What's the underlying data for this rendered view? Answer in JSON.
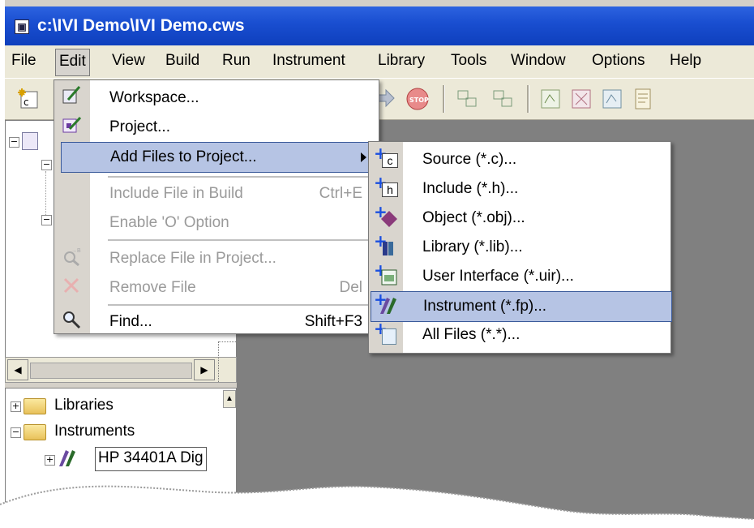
{
  "window": {
    "title": "c:\\IVI Demo\\IVI Demo.cws"
  },
  "menubar": {
    "items": [
      {
        "label": "File"
      },
      {
        "label": "Edit"
      },
      {
        "label": "View"
      },
      {
        "label": "Build"
      },
      {
        "label": "Run"
      },
      {
        "label": "Instrument"
      },
      {
        "label": "Library"
      },
      {
        "label": "Tools"
      },
      {
        "label": "Window"
      },
      {
        "label": "Options"
      },
      {
        "label": "Help"
      }
    ]
  },
  "edit_menu": {
    "items": [
      {
        "label": "Workspace...",
        "shortcut": "",
        "icon": "open-workspace-icon",
        "enabled": true
      },
      {
        "label": "Project...",
        "shortcut": "",
        "icon": "open-project-icon",
        "enabled": true
      },
      {
        "label": "Add Files to Project...",
        "shortcut": "",
        "icon": "",
        "enabled": true,
        "submenu": true
      },
      {
        "label": "Include File in Build",
        "shortcut": "Ctrl+E",
        "icon": "",
        "enabled": false
      },
      {
        "label": "Enable 'O' Option",
        "shortcut": "",
        "icon": "",
        "enabled": false
      },
      {
        "label": "Replace File in Project...",
        "shortcut": "",
        "icon": "replace-file-icon",
        "enabled": false
      },
      {
        "label": "Remove File",
        "shortcut": "Del",
        "icon": "remove-x-icon",
        "enabled": false
      },
      {
        "label": "Find...",
        "shortcut": "Shift+F3",
        "icon": "magnifier-icon",
        "enabled": true
      }
    ]
  },
  "submenu": {
    "items": [
      {
        "label": "Source (*.c)...",
        "icon": "add-source-icon"
      },
      {
        "label": "Include (*.h)...",
        "icon": "add-include-icon"
      },
      {
        "label": "Object (*.obj)...",
        "icon": "add-object-icon"
      },
      {
        "label": "Library (*.lib)...",
        "icon": "add-library-icon"
      },
      {
        "label": "User Interface (*.uir)...",
        "icon": "add-uir-icon"
      },
      {
        "label": "Instrument (*.fp)...",
        "icon": "add-instrument-icon"
      },
      {
        "label": "All Files (*.*)...",
        "icon": "add-all-files-icon"
      }
    ],
    "highlighted_index": 5
  },
  "toolbar_icons": {
    "first": "c"
  },
  "tree_bottom": {
    "items": [
      {
        "label": "Libraries",
        "expander": "+"
      },
      {
        "label": "Instruments",
        "expander": "−"
      },
      {
        "label": "HP 34401A Dig",
        "expander": "+"
      }
    ]
  },
  "colors": {
    "highlight": "#b6c4e4",
    "titlebar": "#1a4fd1",
    "workspace": "#808080"
  }
}
